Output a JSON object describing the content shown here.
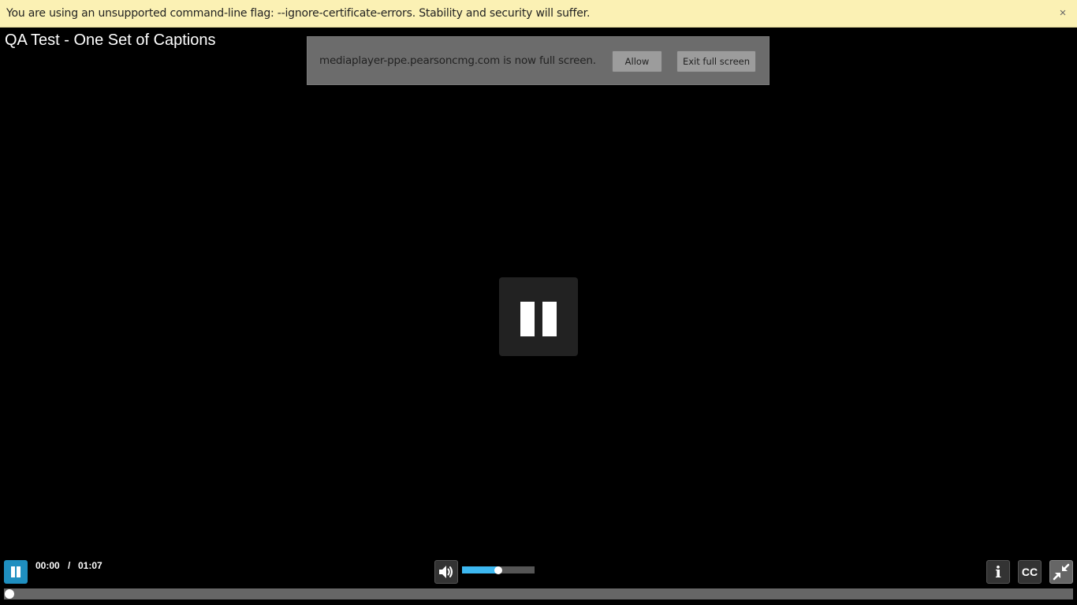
{
  "infobar": {
    "message": "You are using an unsupported command-line flag: --ignore-certificate-errors. Stability and security will suffer.",
    "close_label": "×"
  },
  "player": {
    "title": "QA Test - One Set of Captions",
    "current_time": "00:00",
    "separator": "/",
    "duration": "01:07",
    "progress_fraction": 0.0,
    "volume_fraction": 0.5,
    "info_label": "i",
    "cc_label": "CC",
    "state": "playing"
  },
  "fullscreen_bubble": {
    "message": "mediaplayer-ppe.pearsoncmg.com is now full screen.",
    "allow_label": "Allow",
    "exit_label": "Exit full screen"
  },
  "icons": {
    "center": "pause-icon",
    "play_pause": "pause-icon",
    "volume": "speaker-icon",
    "info": "info-icon",
    "exit_fullscreen": "exit-fullscreen-icon",
    "close": "close-icon"
  },
  "colors": {
    "infobar_bg": "#fbf1b4",
    "accent": "#3db8f0",
    "play_button": "#1f8fc0",
    "background": "#000000"
  }
}
